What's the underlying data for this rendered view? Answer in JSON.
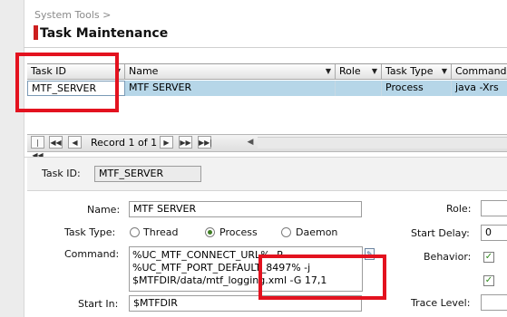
{
  "breadcrumb": "System Tools >",
  "page_title": "Task Maintenance",
  "colors": {
    "accent": "#cc1f1f",
    "selected_row": "#b6d6e8",
    "annotation": "#e3121f",
    "check": "#2d8a1a"
  },
  "grid": {
    "columns": [
      {
        "label": "Task ID"
      },
      {
        "label": "Name"
      },
      {
        "label": "Role"
      },
      {
        "label": "Task Type"
      },
      {
        "label": "Command"
      }
    ],
    "rows": [
      {
        "task_id": "MTF_SERVER",
        "name": "MTF SERVER",
        "role": "",
        "task_type": "Process",
        "command": "java -Xrs"
      }
    ],
    "sort_icon": "triangle-down-icon"
  },
  "pager": {
    "record_text": "Record 1 of 1",
    "first_icon": "first-page-icon",
    "prev_page_icon": "prev-page-icon",
    "prev_icon": "prev-icon",
    "next_icon": "next-icon",
    "next_page_icon": "next-page-icon",
    "last_icon": "last-page-icon"
  },
  "form": {
    "task_id_label": "Task ID:",
    "task_id_value": "MTF_SERVER",
    "name_label": "Name:",
    "name_value": "MTF SERVER",
    "task_type_label": "Task Type:",
    "task_type_options": [
      "Thread",
      "Process",
      "Daemon"
    ],
    "task_type_selected": "Process",
    "command_label": "Command:",
    "command_lines": [
      "%UC_MTF_CONNECT_URL% -P",
      "%UC_MTF_PORT_DEFAULT_8497% -j",
      "$MTFDIR/data/mtf_logging.xml -G 17,1"
    ],
    "start_in_label": "Start In:",
    "start_in_value": "$MTFDIR",
    "role_label": "Role:",
    "role_value": "",
    "start_delay_label": "Start Delay:",
    "start_delay_value": "0",
    "behavior_label": "Behavior:",
    "behavior_checks": [
      true,
      true
    ],
    "trace_level_label": "Trace Level:",
    "trace_level_value": ""
  }
}
